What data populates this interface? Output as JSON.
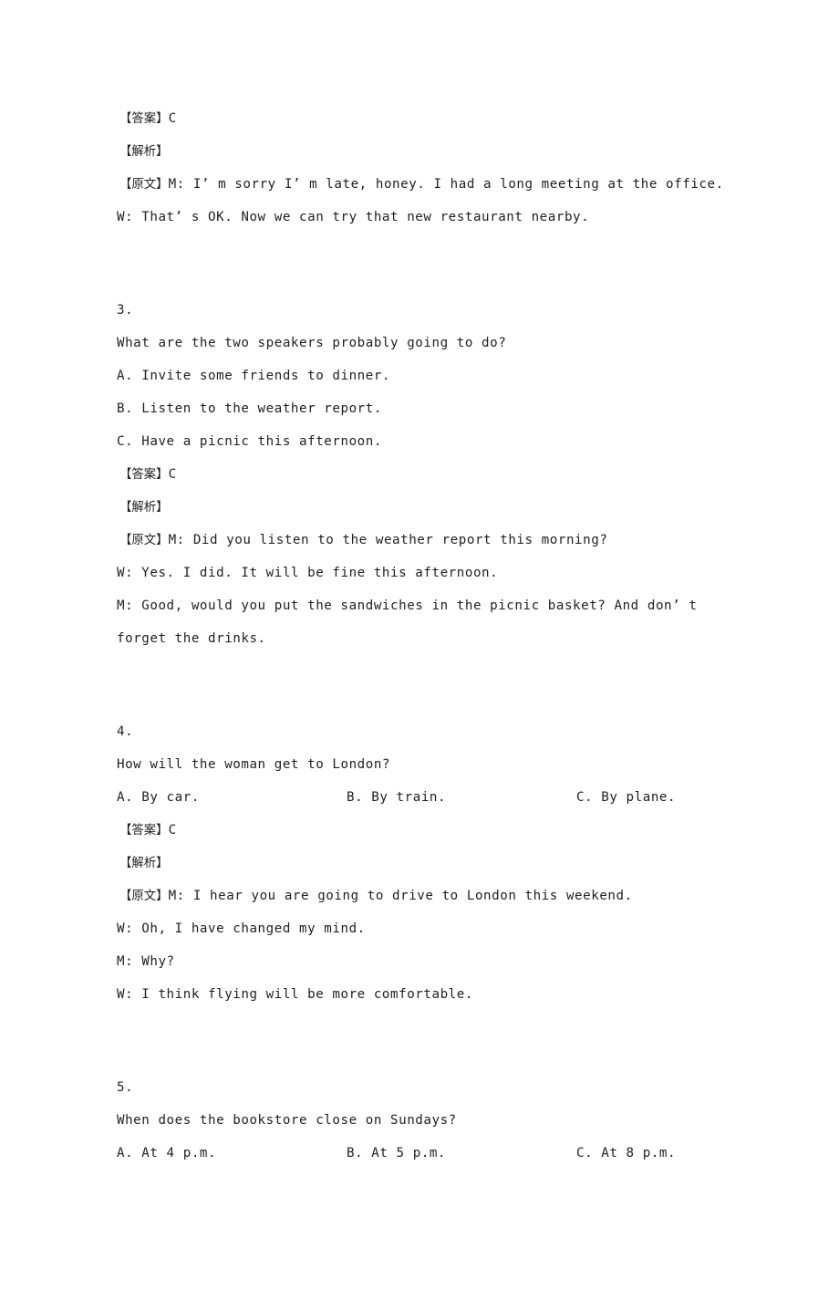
{
  "document": {
    "type": "english-listening-answer-key",
    "page_background": "#ffffff",
    "text_color": "#1f1f1f"
  },
  "labels": {
    "answer": "【答案】",
    "analysis": "【解析】",
    "transcript": "【原文】"
  },
  "blocks": [
    {
      "id": "question-2-key",
      "answer_label": "【答案】",
      "answer_value": "C",
      "analysis_label": "【解析】",
      "transcript_label": "【原文】",
      "transcript_lines": [
        "M: I’ m sorry I’ m late, honey. I had a long meeting at the office.",
        "W: That’ s OK. Now we can try that new restaurant nearby."
      ]
    },
    {
      "id": "question-3",
      "number": "3.",
      "stem": "What are the two speakers probably going to do?",
      "options_stacked": [
        "A. Invite some friends to dinner.",
        "B. Listen to the weather report.",
        "C. Have a picnic this afternoon."
      ],
      "answer_label": "【答案】",
      "answer_value": "C",
      "analysis_label": "【解析】",
      "transcript_label": "【原文】",
      "transcript_lines": [
        "M: Did you listen to the weather report this morning?",
        "W: Yes. I did. It will be fine this afternoon.",
        "M: Good, would you put the sandwiches in the picnic basket? And don’ t forget the drinks."
      ]
    },
    {
      "id": "question-4",
      "number": "4.",
      "stem": "How will the woman get to London?",
      "options_inline": [
        "A. By car.",
        "B. By train.",
        "C. By plane."
      ],
      "answer_label": "【答案】",
      "answer_value": "C",
      "analysis_label": "【解析】",
      "transcript_label": "【原文】",
      "transcript_lines": [
        "M: I hear you are going to drive to London this weekend.",
        "W: Oh, I have changed my mind.",
        "M: Why?",
        "W: I think flying will be more comfortable."
      ]
    },
    {
      "id": "question-5",
      "number": "5.",
      "stem": "When does the bookstore close on Sundays?",
      "options_inline": [
        "A. At 4 p.m.",
        "B. At 5 p.m.",
        "C. At 8 p.m."
      ]
    }
  ]
}
